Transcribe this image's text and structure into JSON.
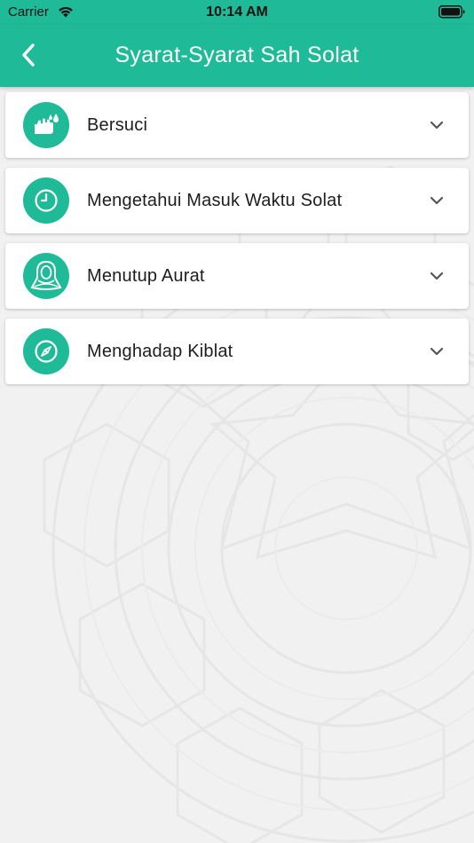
{
  "status_bar": {
    "carrier": "Carrier",
    "time": "10:14 AM",
    "wifi_icon": "wifi-icon",
    "battery_icon": "battery-icon"
  },
  "header": {
    "title": "Syarat-Syarat Sah Solat",
    "back_icon": "chevron-left-icon",
    "background_color": "#1fba97"
  },
  "items": [
    {
      "label": "Bersuci",
      "icon": "hand-washing-icon"
    },
    {
      "label": "Mengetahui Masuk Waktu Solat",
      "icon": "clock-icon"
    },
    {
      "label": "Menutup Aurat",
      "icon": "hijab-woman-icon"
    },
    {
      "label": "Menghadap Kiblat",
      "icon": "compass-icon"
    }
  ],
  "colors": {
    "accent": "#1fba97",
    "background": "#f1f1f1",
    "card": "#ffffff",
    "text": "#1d1d1d"
  }
}
